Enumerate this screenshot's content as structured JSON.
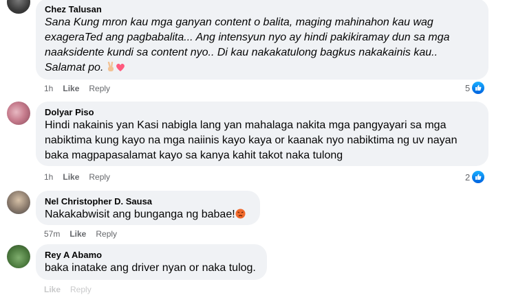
{
  "comments": [
    {
      "author": "Chez Talusan",
      "text": "Sana Kung mron kau mga ganyan content o balita, maging mahinahon kau wag exageraTed ang pagbabalita... Ang intensyun nyo ay hindi pakikiramay dun sa mga naaksidente kundi sa content nyo.. Di kau nakakatulong bagkus nakakainis kau.. Salamat po.",
      "time": "1h",
      "like": "Like",
      "reply": "Reply",
      "reactions": "5"
    },
    {
      "author": "Dolyar Piso",
      "text": "Hindi nakainis yan Kasi nabigla lang yan mahalaga nakita mga pangyayari sa mga nabiktima kung kayo na mga naiinis kayo kaya or kaanak nyo nabiktima ng uv nayan baka magpapasalamat kayo sa kanya kahit takot naka tulong",
      "time": "1h",
      "like": "Like",
      "reply": "Reply",
      "reactions": "2"
    },
    {
      "author": "Nel Christopher D. Sausa",
      "text": "Nakakabwisit ang bunganga ng babae!",
      "time": "57m",
      "like": "Like",
      "reply": "Reply"
    },
    {
      "author": "Rey A Abamo",
      "text": "baka inatake ang driver nyan or naka tulog.",
      "time": "",
      "like": "Like",
      "reply": "Reply"
    }
  ],
  "colors": {
    "bubble": "#f0f2f5",
    "meta": "#65676b",
    "like_blue": "#0866ff"
  },
  "icons": [
    "victory-hand-emoji",
    "heart-emoji",
    "angry-face-emoji",
    "like-icon"
  ]
}
